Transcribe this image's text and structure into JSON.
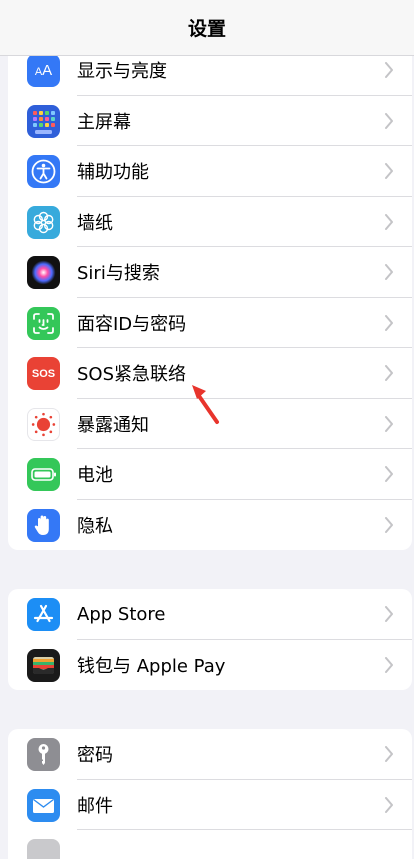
{
  "nav": {
    "title": "设置"
  },
  "groups": [
    {
      "items": [
        {
          "label": "显示与亮度",
          "icon": "display-brightness-icon"
        },
        {
          "label": "主屏幕",
          "icon": "home-screen-icon"
        },
        {
          "label": "辅助功能",
          "icon": "accessibility-icon"
        },
        {
          "label": "墙纸",
          "icon": "wallpaper-flower-icon"
        },
        {
          "label": "Siri与搜索",
          "icon": "siri-icon"
        },
        {
          "label": "面容ID与密码",
          "icon": "face-id-icon"
        },
        {
          "label": "SOS紧急联络",
          "icon": "sos-icon",
          "icon_text": "SOS"
        },
        {
          "label": "暴露通知",
          "icon": "exposure-notification-icon"
        },
        {
          "label": "电池",
          "icon": "battery-icon"
        },
        {
          "label": "隐私",
          "icon": "privacy-hand-icon"
        }
      ]
    },
    {
      "items": [
        {
          "label": "App Store",
          "icon": "app-store-icon"
        },
        {
          "label": "钱包与 Apple Pay",
          "icon": "wallet-icon"
        }
      ]
    },
    {
      "items": [
        {
          "label": "密码",
          "icon": "key-icon"
        },
        {
          "label": "邮件",
          "icon": "mail-icon"
        }
      ]
    }
  ],
  "colors": {
    "blue": "#3478f6",
    "green": "#34c759",
    "red": "#e94235",
    "gray": "#8e8e93"
  }
}
